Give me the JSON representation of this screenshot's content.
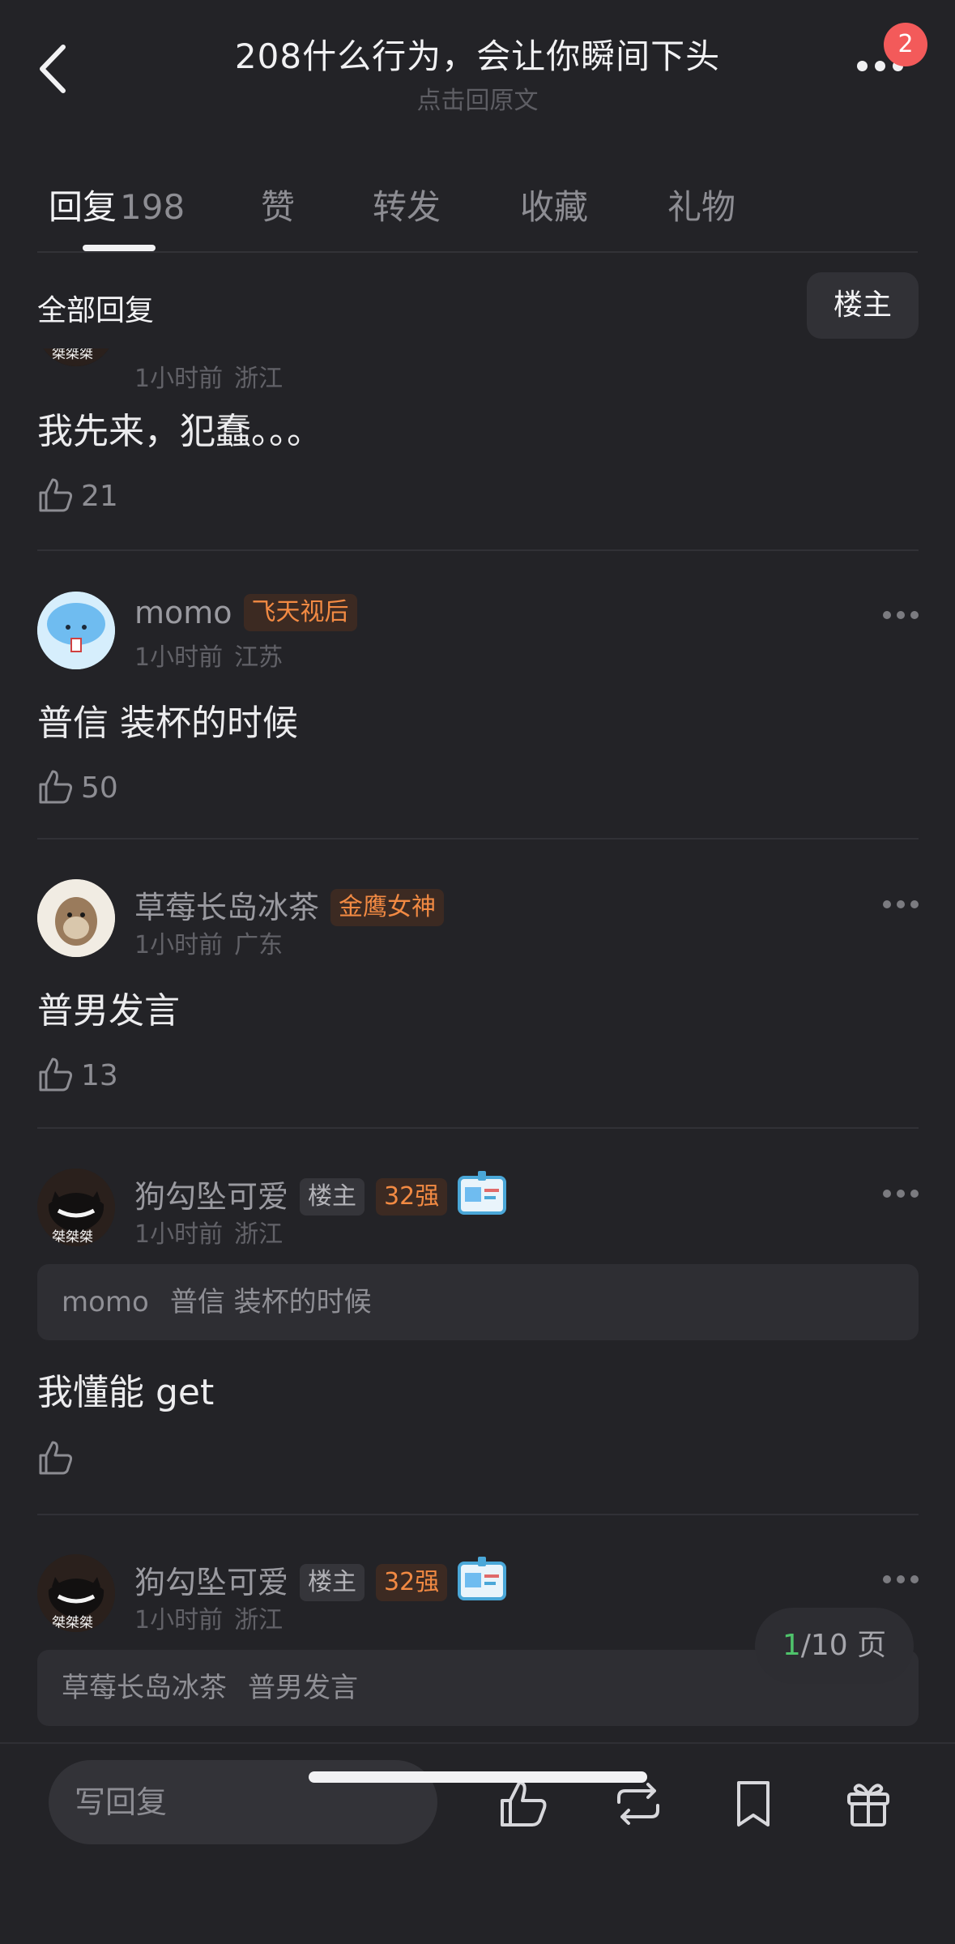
{
  "header": {
    "title": "208什么行为，会让你瞬间下头",
    "subtitle": "点击回原文",
    "notification_count": "2"
  },
  "tabs": [
    {
      "label": "回复",
      "count": "198",
      "active": true
    },
    {
      "label": "赞",
      "active": false
    },
    {
      "label": "转发",
      "active": false
    },
    {
      "label": "收藏",
      "active": false
    },
    {
      "label": "礼物",
      "active": false
    }
  ],
  "section": {
    "title": "全部回复",
    "op_filter_label": "楼主"
  },
  "comments": [
    {
      "time": "1小时前",
      "location": "浙江",
      "text": "我先来，犯蠢。。。",
      "likes": "21",
      "avatar_text": "桀桀桀"
    },
    {
      "username": "momo",
      "tag": "飞天视后",
      "time": "1小时前",
      "location": "江苏",
      "text": "普信 装杯的时候",
      "likes": "50"
    },
    {
      "username": "草莓长岛冰茶",
      "tag": "金鹰女神",
      "time": "1小时前",
      "location": "广东",
      "text": "普男发言",
      "likes": "13"
    },
    {
      "username": "狗勾坠可爱",
      "tag_op": "楼主",
      "tag_rank": "32强",
      "time": "1小时前",
      "location": "浙江",
      "quote_user": "momo",
      "quote_text": "普信 装杯的时候",
      "text": "我懂能 get",
      "likes": "",
      "avatar_text": "桀桀桀"
    },
    {
      "username": "狗勾坠可爱",
      "tag_op": "楼主",
      "tag_rank": "32强",
      "time": "1小时前",
      "location": "浙江",
      "quote_user": "草莓长岛冰茶",
      "quote_text": "普男发言",
      "avatar_text": "桀桀桀"
    }
  ],
  "pagination": {
    "current": "1",
    "total_label": "/10 页"
  },
  "bottom_bar": {
    "reply_placeholder": "写回复",
    "icons": [
      "thumbs-up-icon",
      "repost-icon",
      "bookmark-icon",
      "gift-icon"
    ]
  },
  "colors": {
    "background": "#232327",
    "accent_orange": "#f28a43",
    "badge_red": "#f35a5a",
    "page_current_green": "#4fc36b"
  }
}
